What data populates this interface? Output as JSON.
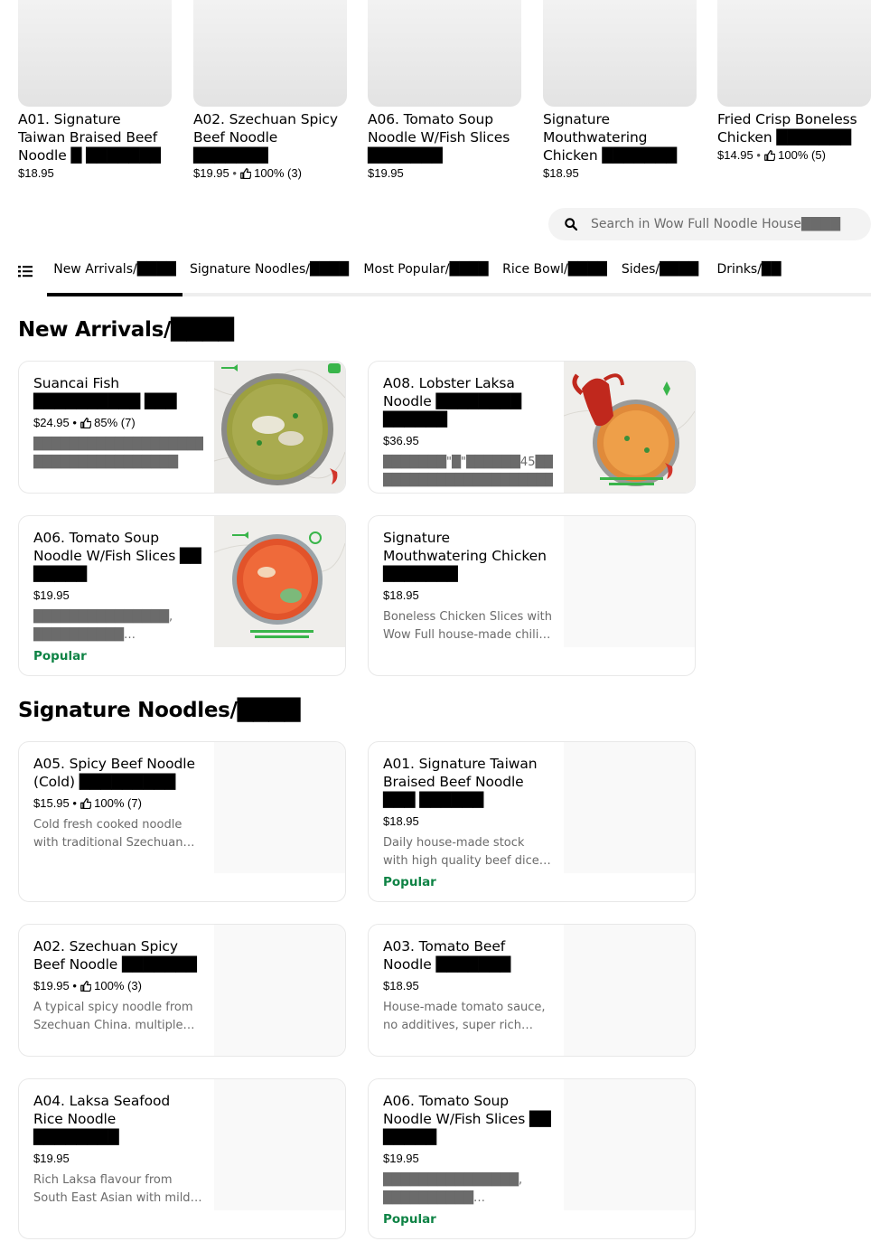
{
  "carousel": [
    {
      "title": "A01. Signature Taiwan Braised Beef Noodle █ ███████",
      "price": "$18.95",
      "rating": ""
    },
    {
      "title": "A02. Szechuan Spicy Beef Noodle ███████",
      "price": "$19.95",
      "rating": "100% (3)"
    },
    {
      "title": "A06. Tomato Soup Noodle W/Fish Slices ███████",
      "price": "$19.95",
      "rating": ""
    },
    {
      "title": "Signature Mouthwatering Chicken ███████",
      "price": "$18.95",
      "rating": ""
    },
    {
      "title": "Fried Crisp Boneless Chicken ███████",
      "price": "$14.95",
      "rating": "100% (5)"
    }
  ],
  "search": {
    "placeholder": "Search in Wow Full Noodle House████"
  },
  "tabs": [
    {
      "label": "New Arrivals/████"
    },
    {
      "label": "Signature Noodles/████"
    },
    {
      "label": "Most Popular/████"
    },
    {
      "label": "Rice Bowl/████"
    },
    {
      "label": "Sides/████"
    },
    {
      "label": "Drinks/██"
    }
  ],
  "sections": [
    {
      "title": "New Arrivals/████",
      "items": [
        {
          "title": "Suancai Fish ██████████ ███",
          "price": "$24.95",
          "rating": "85% (7)",
          "desc": "██████████████████████████ ████████████████",
          "badge": "",
          "image": "sauerkraut-fish-soup"
        },
        {
          "title": "A08. Lobster Laksa Noodle ████████ ██████",
          "price": "$36.95",
          "rating": "",
          "desc": "███████\"█\"██████45████████ ████████████████████████████",
          "badge": "",
          "image": "lobster-laksa-noodle"
        },
        {
          "title": "A06. Tomato Soup Noodle W/Fish Slices ██ █████",
          "price": "$19.95",
          "rating": "",
          "desc": "███████████████, ██████████ ███████████████Q███████████",
          "badge": "Popular",
          "image": "tomato-fish-soup-noodle"
        },
        {
          "title": "Signature Mouthwatering Chicken ███████",
          "price": "$18.95",
          "rating": "",
          "desc": "Boneless Chicken Slices with Wow Full house-made chili oil sauce",
          "badge": "",
          "image": ""
        }
      ]
    },
    {
      "title": "Signature Noodles/████",
      "items": [
        {
          "title": "A05. Spicy Beef Noodle (Cold) █████████",
          "price": "$15.95",
          "rating": "100% (7)",
          "desc": "Cold fresh cooked noodle with traditional Szechuan spicy sauce",
          "badge": "",
          "image": ""
        },
        {
          "title": "A01. Signature Taiwan Braised Beef Noodle ███ ██████",
          "price": "$18.95",
          "rating": "",
          "desc": "Daily house-made stock with high quality beef dices and bok choy",
          "badge": "Popular",
          "image": ""
        },
        {
          "title": "A02. Szechuan Spicy Beef Noodle ███████",
          "price": "$19.95",
          "rating": "100% (3)",
          "desc": "A typical spicy noodle from Szechuan China. multiple spices",
          "badge": "",
          "image": ""
        },
        {
          "title": "A03. Tomato Beef Noodle ███████",
          "price": "$18.95",
          "rating": "",
          "desc": "House-made tomato sauce, no additives, super rich flavour",
          "badge": "",
          "image": ""
        },
        {
          "title": "A04. Laksa Seafood Rice Noodle ████████",
          "price": "$19.95",
          "rating": "",
          "desc": "Rich Laksa flavour from South East Asian with mild spicy coconut",
          "badge": "",
          "image": ""
        },
        {
          "title": "A06. Tomato Soup Noodle W/Fish Slices ██ █████",
          "price": "$19.95",
          "rating": "",
          "desc": "███████████████, ██████████ ███████████████Q███████████",
          "badge": "Popular",
          "image": ""
        }
      ]
    }
  ],
  "colors": {
    "popular": "#0e8345",
    "search_bg": "#f3f3f3",
    "tab_active": "#000000"
  }
}
